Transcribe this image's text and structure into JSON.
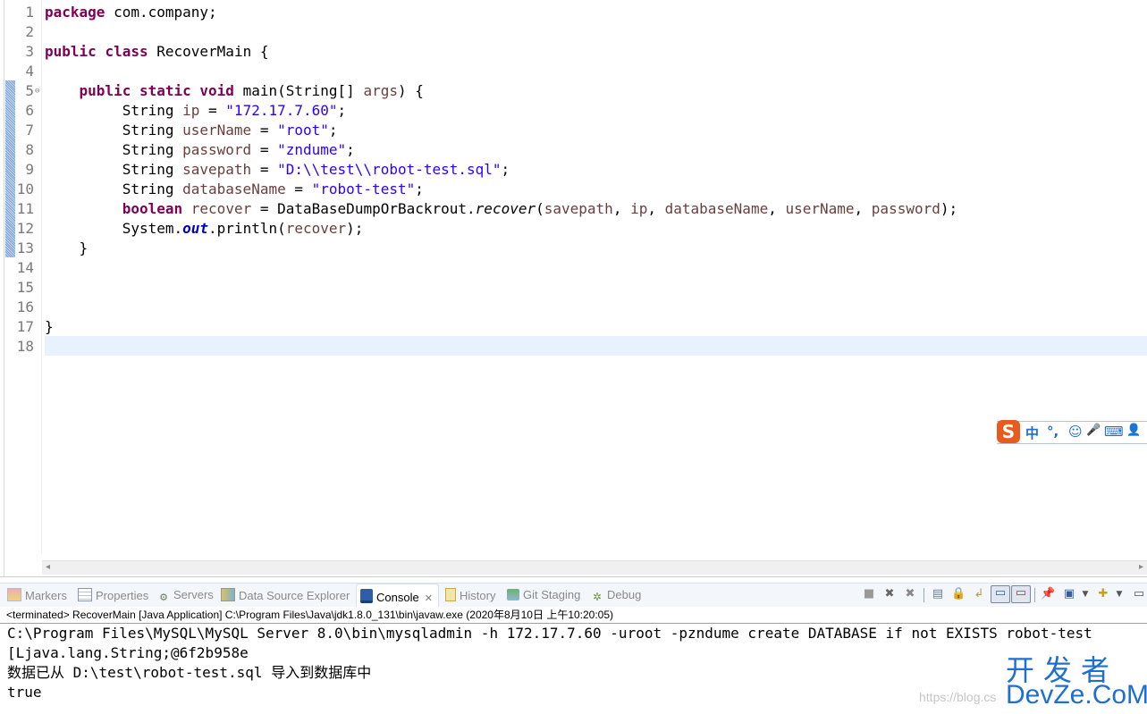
{
  "editor": {
    "lines": [
      {
        "n": "1",
        "tokens": [
          {
            "t": "package",
            "c": "kw"
          },
          {
            "t": " com.company;",
            "c": ""
          }
        ]
      },
      {
        "n": "2",
        "tokens": []
      },
      {
        "n": "3",
        "tokens": [
          {
            "t": "public",
            "c": "kw"
          },
          {
            "t": " ",
            "c": ""
          },
          {
            "t": "class",
            "c": "kw"
          },
          {
            "t": " RecoverMain {",
            "c": ""
          }
        ]
      },
      {
        "n": "4",
        "tokens": []
      },
      {
        "n": "5",
        "fold": true,
        "tokens": [
          {
            "t": "    ",
            "c": ""
          },
          {
            "t": "public",
            "c": "kw"
          },
          {
            "t": " ",
            "c": ""
          },
          {
            "t": "static",
            "c": "kw"
          },
          {
            "t": " ",
            "c": ""
          },
          {
            "t": "void",
            "c": "kw"
          },
          {
            "t": " main(String[] ",
            "c": ""
          },
          {
            "t": "args",
            "c": "var"
          },
          {
            "t": ") {",
            "c": ""
          }
        ]
      },
      {
        "n": "6",
        "tokens": [
          {
            "t": "         String ",
            "c": ""
          },
          {
            "t": "ip",
            "c": "var"
          },
          {
            "t": " = ",
            "c": ""
          },
          {
            "t": "\"172.17.7.60\"",
            "c": "str"
          },
          {
            "t": ";",
            "c": ""
          }
        ]
      },
      {
        "n": "7",
        "tokens": [
          {
            "t": "         String ",
            "c": ""
          },
          {
            "t": "userName",
            "c": "var"
          },
          {
            "t": " = ",
            "c": ""
          },
          {
            "t": "\"root\"",
            "c": "str"
          },
          {
            "t": ";",
            "c": ""
          }
        ]
      },
      {
        "n": "8",
        "tokens": [
          {
            "t": "         String ",
            "c": ""
          },
          {
            "t": "password",
            "c": "var"
          },
          {
            "t": " = ",
            "c": ""
          },
          {
            "t": "\"zndume\"",
            "c": "str"
          },
          {
            "t": ";",
            "c": ""
          }
        ]
      },
      {
        "n": "9",
        "tokens": [
          {
            "t": "         String ",
            "c": ""
          },
          {
            "t": "savepath",
            "c": "var"
          },
          {
            "t": " = ",
            "c": ""
          },
          {
            "t": "\"D:\\\\test\\\\robot-test.sql\"",
            "c": "str"
          },
          {
            "t": ";",
            "c": ""
          }
        ]
      },
      {
        "n": "10",
        "tokens": [
          {
            "t": "         String ",
            "c": ""
          },
          {
            "t": "databaseName",
            "c": "var"
          },
          {
            "t": " = ",
            "c": ""
          },
          {
            "t": "\"robot-test\"",
            "c": "str"
          },
          {
            "t": ";",
            "c": ""
          }
        ]
      },
      {
        "n": "11",
        "tokens": [
          {
            "t": "         ",
            "c": ""
          },
          {
            "t": "boolean",
            "c": "kw"
          },
          {
            "t": " ",
            "c": ""
          },
          {
            "t": "recover",
            "c": "var"
          },
          {
            "t": " = DataBaseDumpOrBackrout.",
            "c": ""
          },
          {
            "t": "recover",
            "c": "it"
          },
          {
            "t": "(",
            "c": ""
          },
          {
            "t": "savepath",
            "c": "var"
          },
          {
            "t": ", ",
            "c": ""
          },
          {
            "t": "ip",
            "c": "var"
          },
          {
            "t": ", ",
            "c": ""
          },
          {
            "t": "databaseName",
            "c": "var"
          },
          {
            "t": ", ",
            "c": ""
          },
          {
            "t": "userName",
            "c": "var"
          },
          {
            "t": ", ",
            "c": ""
          },
          {
            "t": "password",
            "c": "var"
          },
          {
            "t": ");",
            "c": ""
          }
        ]
      },
      {
        "n": "12",
        "tokens": [
          {
            "t": "         System.",
            "c": ""
          },
          {
            "t": "out",
            "c": "fld"
          },
          {
            "t": ".println(",
            "c": ""
          },
          {
            "t": "recover",
            "c": "var"
          },
          {
            "t": ");",
            "c": ""
          }
        ]
      },
      {
        "n": "13",
        "tokens": [
          {
            "t": "    }",
            "c": ""
          }
        ]
      },
      {
        "n": "14",
        "tokens": []
      },
      {
        "n": "15",
        "tokens": []
      },
      {
        "n": "16",
        "tokens": []
      },
      {
        "n": "17",
        "tokens": [
          {
            "t": "}",
            "c": ""
          }
        ]
      },
      {
        "n": "18",
        "tokens": []
      }
    ]
  },
  "ime": {
    "logo": "S",
    "mode": "中",
    "punct": "°,",
    "emoji_icon": "☺",
    "mic_icon": "🎤",
    "keyboard_icon": "⌨",
    "user_icon": "👤"
  },
  "panel": {
    "tabs": [
      {
        "label": "Markers",
        "icon": "markers-icon"
      },
      {
        "label": "Properties",
        "icon": "properties-icon"
      },
      {
        "label": "Servers",
        "icon": "servers-icon"
      },
      {
        "label": "Data Source Explorer",
        "icon": "data-source-icon"
      },
      {
        "label": "Console",
        "icon": "console-icon",
        "active": true
      },
      {
        "label": "History",
        "icon": "history-icon"
      },
      {
        "label": "Git Staging",
        "icon": "git-staging-icon"
      },
      {
        "label": "Debug",
        "icon": "debug-icon"
      }
    ],
    "status": "<terminated> RecoverMain [Java Application] C:\\Program Files\\Java\\jdk1.8.0_131\\bin\\javaw.exe (2020年8月10日 上午10:20:05)"
  },
  "console": {
    "lines": [
      "C:\\Program Files\\MySQL\\MySQL Server 8.0\\bin\\mysqladmin -h 172.17.7.60 -uroot -pzndume create DATABASE if not EXISTS robot-test",
      "[Ljava.lang.String;@6f2b958e",
      "数据已从 D:\\test\\robot-test.sql 导入到数据库中",
      "true"
    ]
  },
  "watermark": {
    "cn": "开发者",
    "en": "DevZe.CoM",
    "faint": "https://blog.cs"
  }
}
